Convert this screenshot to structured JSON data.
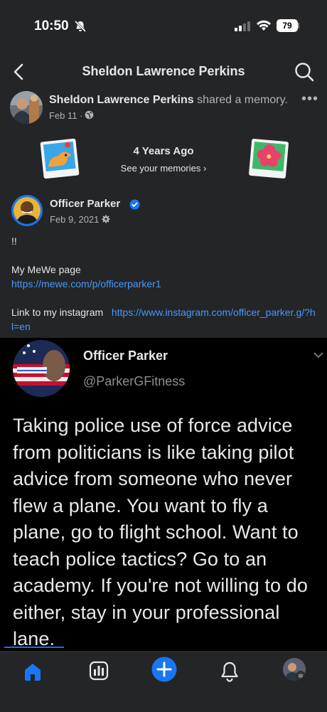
{
  "status_bar": {
    "time": "10:50",
    "battery": "79"
  },
  "nav": {
    "title": "Sheldon Lawrence Perkins"
  },
  "post": {
    "author": "Sheldon Lawrence Perkins",
    "action": " shared a memory.",
    "date": "Feb 11 ·",
    "more": "•••"
  },
  "memory": {
    "title": "4 Years Ago",
    "link": "See your memories ›"
  },
  "shared_post": {
    "author": "Officer Parker",
    "date": "Feb 9, 2021 ·",
    "line1": "!!",
    "mewe_label": "My MeWe page",
    "mewe_url": "https://mewe.com/p/officerparker1",
    "instagram_label": "Link to my instagram",
    "instagram_url": "https://www.instagram.com/officer_parker.g/?hl=en"
  },
  "tweet": {
    "name": "Officer Parker",
    "handle": "@ParkerGFitness",
    "text": "Taking police use of force advice from politicians is like taking pilot advice from someone who never flew a plane. You want to fly a plane, go to flight school. Want to teach police tactics? Go to an academy. If you're not willing to do either, stay in your professional lane."
  },
  "colors": {
    "background": "#242526",
    "link": "#4599ff",
    "accent": "#1877f2",
    "tweet_background": "#000000"
  },
  "icons": {
    "status": [
      "bell-off-icon",
      "signal-icon",
      "wifi-icon",
      "battery-icon"
    ],
    "nav": [
      "back-icon",
      "search-icon"
    ],
    "tabs": [
      "home-icon",
      "dashboard-icon",
      "create-icon",
      "bell-icon",
      "profile-avatar"
    ]
  }
}
